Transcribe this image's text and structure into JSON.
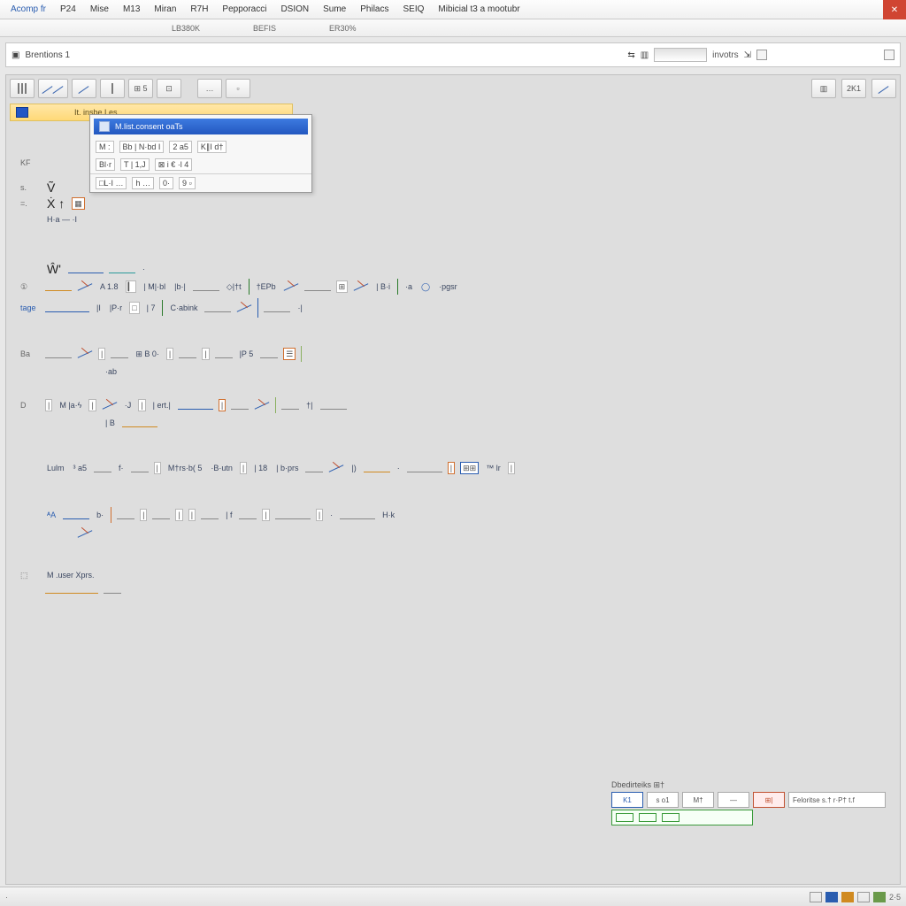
{
  "menu": {
    "items": [
      "Acomp fr",
      "P24",
      "Mise",
      "M13",
      "Miran",
      "R7H",
      "Pepporacci",
      "DSION",
      "Sume",
      "Philacs",
      "SEIQ",
      "Mibicial t3 a mootubr"
    ],
    "close": "✕"
  },
  "tabbar": {
    "items": [
      "",
      "",
      "",
      "LB380K",
      "BEFIS",
      "ER30%",
      ""
    ]
  },
  "subheader": {
    "doc_icon": "▣",
    "doc_title": "Brentions   1",
    "search_icons": [
      "⇆",
      "▥"
    ],
    "search_label": "invotrs",
    "trailing_icons": [
      "⇲",
      "|"
    ]
  },
  "toolbar": {
    "buttons": [
      {
        "name": "tool-histogram",
        "label": "▥"
      },
      {
        "name": "tool-lines",
        "label": "⫫"
      },
      {
        "name": "tool-curve",
        "label": "↗"
      },
      {
        "name": "tool-vbar",
        "label": "|"
      },
      {
        "name": "tool-grid",
        "label": "⊞ 5"
      },
      {
        "name": "tool-misc",
        "label": "⊡"
      },
      {
        "name": "tool-small-a",
        "label": "…"
      },
      {
        "name": "tool-small-b",
        "label": "▫"
      }
    ],
    "right": [
      {
        "name": "tool-chart",
        "label": "▥"
      },
      {
        "name": "tool-num",
        "label": "2K1"
      },
      {
        "name": "tool-arrow",
        "label": "↗"
      }
    ]
  },
  "docstrip": {
    "label": "It. insbe Les"
  },
  "popup": {
    "message": "M.list.consent    oaTs",
    "row1": [
      "M :",
      "Bb | N·bd I",
      "2 a5",
      "K∥I d†"
    ],
    "row2": [
      "Bl·r",
      "T | 1,J",
      "⊠ i € ·l 4"
    ],
    "row3": [
      "□L·I …",
      "h …",
      "0·",
      "9 ▫"
    ]
  },
  "content": {
    "hdr": {
      "label": "KF"
    },
    "r1": {
      "label": "s.",
      "text": "Ṽ"
    },
    "r2": {
      "label": "=.",
      "text": "Ẋ ↑"
    },
    "r3": {
      "label": "",
      "text": "H·a  —  ·I"
    },
    "formula1": {
      "label": "",
      "lead": "Ŵ'",
      "tokens": [
        "⟶",
        "—",
        "·"
      ]
    },
    "formula2": {
      "label": "①",
      "lead": "",
      "tokens": [
        "▂",
        "A 1.8",
        "▎",
        "| M|·bl",
        "|b·|",
        "⟶",
        "◇|†t",
        "|",
        "†EPb",
        "✕",
        "⟶",
        "⊞",
        "△",
        "| B·i",
        "|",
        "·a",
        "◯",
        "·pgsr"
      ]
    },
    "formula3": {
      "label": "tage",
      "tokens": [
        "⟶",
        "|I",
        "|P·r",
        "|□",
        "| 7",
        "|",
        "C·abink",
        "⟶",
        "A",
        "|",
        "⟶",
        "·|"
      ]
    },
    "row4": {
      "label": "Ba",
      "tokens": [
        "⟶",
        "△",
        "|",
        "⟶",
        "⊞ B",
        "0·",
        "|",
        "⟶",
        "|",
        "⟶",
        "|P 5",
        "⟶",
        "☰",
        "|"
      ]
    },
    "row5": {
      "label": "",
      "tokens": [
        "·ab"
      ]
    },
    "row6": {
      "label": "D",
      "tokens": [
        "|",
        "M",
        "|a·ϟ",
        "|",
        "·J",
        "|",
        "| ert.|",
        "⟶",
        "|",
        "⟶",
        "†",
        "|",
        "⟶",
        "|",
        "†|",
        "⟶"
      ]
    },
    "row7": {
      "label": "",
      "tokens": [
        "| B",
        "⟶"
      ]
    },
    "row8": {
      "label": "",
      "tokens": [
        "Lulm",
        "³ a5",
        "—",
        "f·",
        "⟶",
        "|",
        "M†rs·b( 5",
        "·B·utn",
        "|",
        "| 18",
        "| b·prs",
        "⟶",
        "|)",
        "⟶",
        "·",
        "⟶",
        "|",
        "|",
        "⊞⊞",
        "™ lr",
        "|"
      ]
    },
    "row9": {
      "label": "",
      "tokens": [
        "ᴬA",
        "⟶",
        "b·",
        "|",
        "⟶",
        "|",
        "⟶",
        "|",
        "|",
        "⟶",
        "| f",
        "⟶",
        "|",
        "⟶",
        "|",
        "·",
        "⟶",
        "H·k"
      ]
    },
    "row10": {
      "label": "",
      "tokens": [
        "A"
      ]
    },
    "footer": {
      "label": "⬚",
      "text": "M   .user Xprs."
    }
  },
  "props": {
    "title": "Dbedirteiks    ⊞†",
    "cells": [
      "K1",
      "s o1",
      "M†",
      "—",
      "⊞|"
    ],
    "wide": "Feloritse  s.† r·P† t.f"
  },
  "status": {
    "left": "·",
    "right_chips": [
      "",
      "",
      "",
      ""
    ],
    "right_text": "2·5"
  }
}
